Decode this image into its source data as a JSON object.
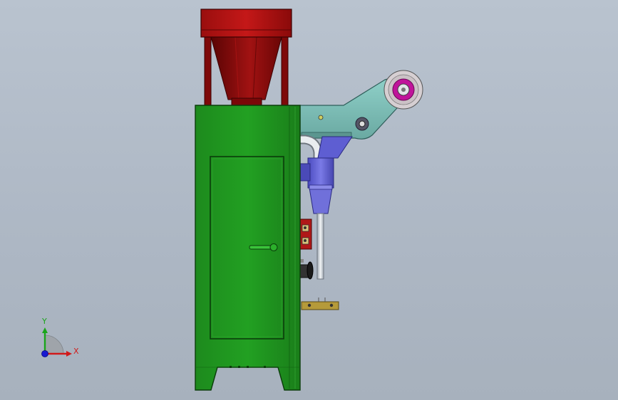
{
  "viewport": {
    "background_top": "#b9c3cf",
    "background_bottom": "#a7b1bd"
  },
  "model": {
    "colors": {
      "frame": "#1f8f1f",
      "frame_dark": "#0f5e0f",
      "hopper": "#8e0b0b",
      "hopper_dark": "#5a0404",
      "arm": "#7fc2bb",
      "bracket": "#6a6ad8",
      "roll_outer": "#d4c8c8",
      "roll_inner": "#c0149a",
      "brass": "#b59a3a",
      "pipe": "#d8dde2"
    }
  },
  "triad": {
    "x_label": "X",
    "y_label": "Y",
    "x_color": "#d11a1a",
    "y_color": "#1aa51a",
    "z_color": "#1a1ad1"
  }
}
